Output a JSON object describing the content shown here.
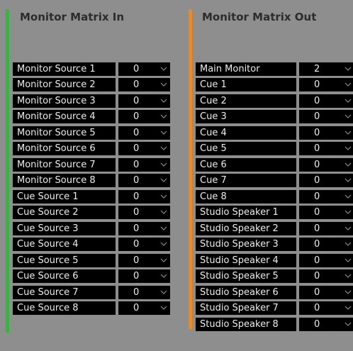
{
  "colors": {
    "in_accent": "#3fae49",
    "out_accent": "#e58a2e",
    "chevron": "#8a8a8a"
  },
  "matrix_in": {
    "title": "Monitor Matrix In",
    "rows": [
      {
        "label": "Monitor Source 1",
        "value": "0"
      },
      {
        "label": "Monitor Source 2",
        "value": "0"
      },
      {
        "label": "Monitor Source 3",
        "value": "0"
      },
      {
        "label": "Monitor Source 4",
        "value": "0"
      },
      {
        "label": "Monitor Source 5",
        "value": "0"
      },
      {
        "label": "Monitor Source 6",
        "value": "0"
      },
      {
        "label": "Monitor Source 7",
        "value": "0"
      },
      {
        "label": "Monitor Source 8",
        "value": "0"
      },
      {
        "label": "Cue Source 1",
        "value": "0"
      },
      {
        "label": "Cue Source 2",
        "value": "0"
      },
      {
        "label": "Cue Source 3",
        "value": "0"
      },
      {
        "label": "Cue Source 4",
        "value": "0"
      },
      {
        "label": "Cue Source 5",
        "value": "0"
      },
      {
        "label": "Cue Source 6",
        "value": "0"
      },
      {
        "label": "Cue Source 7",
        "value": "0"
      },
      {
        "label": "Cue Source 8",
        "value": "0"
      }
    ]
  },
  "matrix_out": {
    "title": "Monitor Matrix Out",
    "rows": [
      {
        "label": "Main Monitor",
        "value": "2"
      },
      {
        "label": "Cue 1",
        "value": "0"
      },
      {
        "label": "Cue 2",
        "value": "0"
      },
      {
        "label": "Cue 3",
        "value": "0"
      },
      {
        "label": "Cue 4",
        "value": "0"
      },
      {
        "label": "Cue 5",
        "value": "0"
      },
      {
        "label": "Cue 6",
        "value": "0"
      },
      {
        "label": "Cue 7",
        "value": "0"
      },
      {
        "label": "Cue 8",
        "value": "0"
      },
      {
        "label": "Studio Speaker 1",
        "value": "0"
      },
      {
        "label": "Studio Speaker 2",
        "value": "0"
      },
      {
        "label": "Studio Speaker 3",
        "value": "0"
      },
      {
        "label": "Studio Speaker 4",
        "value": "0"
      },
      {
        "label": "Studio Speaker 5",
        "value": "0"
      },
      {
        "label": "Studio Speaker 6",
        "value": "0"
      },
      {
        "label": "Studio Speaker 7",
        "value": "0"
      },
      {
        "label": "Studio Speaker 8",
        "value": "0"
      }
    ]
  }
}
